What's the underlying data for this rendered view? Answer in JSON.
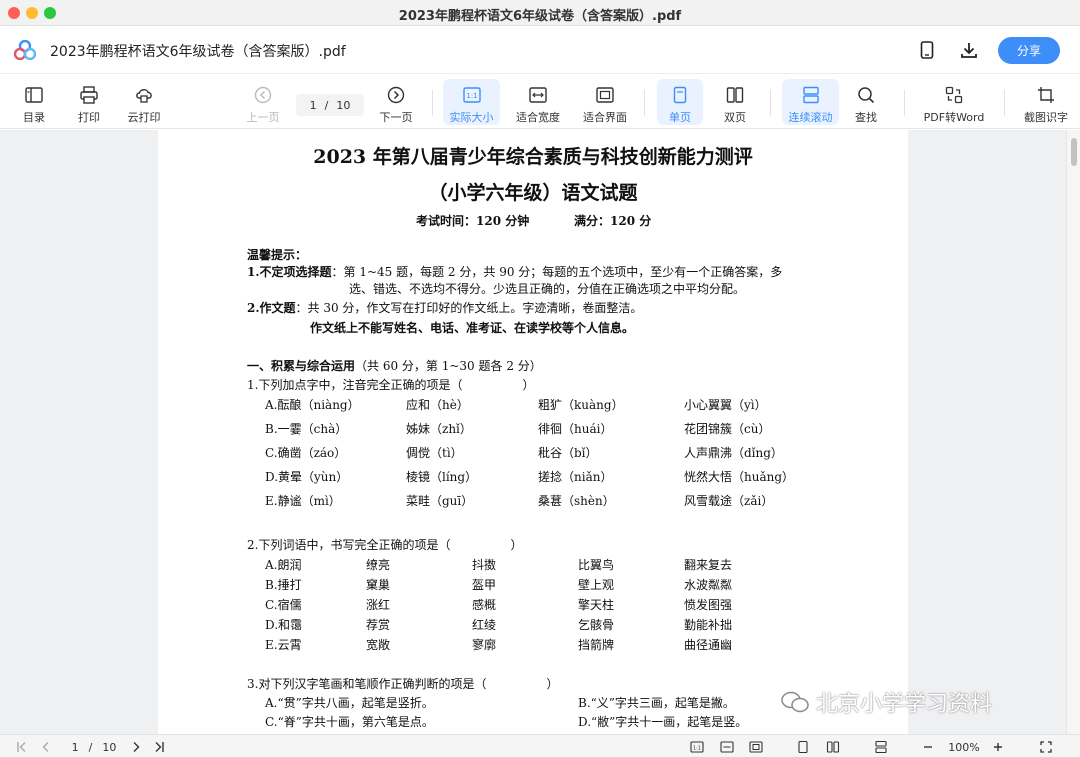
{
  "window": {
    "title": "2023年鹏程杯语文6年级试卷（含答案版）.pdf"
  },
  "header": {
    "doc_title": "2023年鹏程杯语文6年级试卷（含答案版）.pdf",
    "share_label": "分享",
    "accent": "#3d8ef8"
  },
  "toolbar": {
    "toc": "目录",
    "print": "打印",
    "cloud_print": "云打印",
    "prev_page": "上一页",
    "page_current": "1",
    "page_sep": "/",
    "page_total": "10",
    "next_page": "下一页",
    "actual_size": "实际大小",
    "fit_width": "适合宽度",
    "fit_page": "适合界面",
    "single_page": "单页",
    "double_page": "双页",
    "continuous": "连续滚动",
    "find": "查找",
    "pdf_to_word": "PDF转Word",
    "ocr": "截图识字"
  },
  "document": {
    "title1": "2023 年第八届青少年综合素质与科技创新能力测评",
    "title2": "（小学六年级）语文试题",
    "exam_time": "考试时间：120 分钟",
    "full_score": "满分：120 分",
    "tips_heading": "温馨提示：",
    "tip1_label": "1.不定项选择题",
    "tip1_text": "：第 1~45 题，每题 2 分，共 90 分；每题的五个选项中，至少有一个正确答案，多",
    "tip1_text2": "选、错选、不选均不得分。少选且正确的，分值在正确选项之中平均分配。",
    "tip2_label": "2.作文题",
    "tip2_text": "：共 30 分，作文写在打印好的作文纸上。字迹清晰，卷面整洁。",
    "tip2_bold": "作文纸上不能写姓名、电话、准考证、在读学校等个人信息。",
    "section1_label": "一、积累与综合运用",
    "section1_note": "（共 60 分，第 1~30 题各 2 分）",
    "q1": "1.下列加点字中，注音完全正确的项是（　　　　　）",
    "q1_options": [
      [
        "A.酝酿（niàng）",
        "应和（hè）",
        "粗犷（kuàng）",
        "小心翼翼（yì）"
      ],
      [
        "B.一霎（chà）",
        "姊妹（zhǐ）",
        "徘徊（huái）",
        "花团锦簇（cù）"
      ],
      [
        "C.确凿（záo）",
        "倜傥（tì）",
        "秕谷（bǐ）",
        "人声鼎沸（dǐng）"
      ],
      [
        "D.黄晕（yùn）",
        "棱镜（líng）",
        "搓捻（niǎn）",
        "恍然大悟（huǎng）"
      ],
      [
        "E.静谧（mì）",
        "菜畦（guī）",
        "桑葚（shèn）",
        "风雪载途（zǎi）"
      ]
    ],
    "q2": "2.下列词语中，书写完全正确的项是（　　　　　）",
    "q2_options": [
      [
        "A.朗润",
        "缭亮",
        "抖擞",
        "比翼鸟",
        "翻来复去"
      ],
      [
        "B.捶打",
        "窠巢",
        "盔甲",
        "壁上观",
        "水波粼粼"
      ],
      [
        "C.宿儒",
        "涨红",
        "感概",
        "擎天柱",
        "愤发图强"
      ],
      [
        "D.和霭",
        "荐赏",
        "红绫",
        "乞骸骨",
        "勤能补拙"
      ],
      [
        "E.云霄",
        "宽敞",
        "寥廓",
        "挡箭牌",
        "曲径通幽"
      ]
    ],
    "q3": "3.对下列汉字笔画和笔顺作正确判断的项是（　　　　　）",
    "q3_options": [
      [
        "A.“贯”字共八画，起笔是竖折。",
        "B.“义”字共三画，起笔是撇。"
      ],
      [
        "C.“脊”字共十画，第六笔是点。",
        "D.“敝”字共十一画，起笔是竖。"
      ]
    ]
  },
  "watermark": "北京小学学习资料",
  "bottom": {
    "page_current": "1",
    "page_sep": "/",
    "page_total": "10",
    "zoom": "100%"
  }
}
